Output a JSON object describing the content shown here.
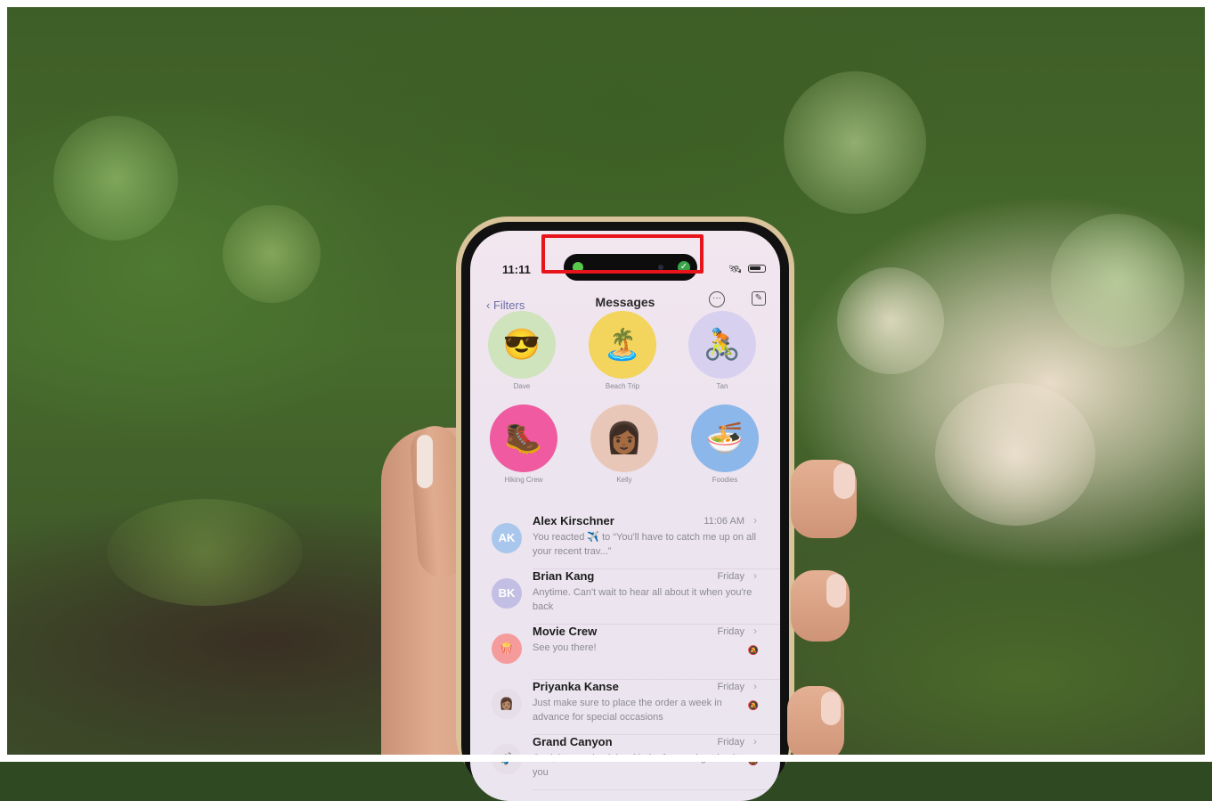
{
  "status_bar": {
    "time": "11:11",
    "battery_level": 0.8
  },
  "nav": {
    "back_label": "Filters",
    "title": "Messages",
    "more_icon": "ellipsis-circle-icon",
    "compose_icon": "compose-icon"
  },
  "pinned": [
    {
      "label": "Dave",
      "emoji": "😎",
      "bg": "#cfe3bd"
    },
    {
      "label": "Beach Trip",
      "emoji": "🏝️",
      "bg": "#f3d45d"
    },
    {
      "label": "Tan",
      "emoji": "🚴",
      "bg": "#d8d0ef"
    },
    {
      "label": "Hiking Crew",
      "emoji": "🥾",
      "bg": "#ef5aa0"
    },
    {
      "label": "Kelly",
      "emoji": "👩🏾",
      "bg": "#e9c7b8"
    },
    {
      "label": "Foodies",
      "emoji": "🍜",
      "bg": "#8cb7ea"
    }
  ],
  "conversations": [
    {
      "name": "Alex Kirschner",
      "date": "11:06 AM",
      "initials": "AK",
      "avatar_bg": "#a9c6ec",
      "preview": "You reacted ✈️ to “You'll have to catch me up on all your recent trav...”",
      "muted": false
    },
    {
      "name": "Brian Kang",
      "date": "Friday",
      "initials": "BK",
      "avatar_bg": "#c3bfe4",
      "preview": "Anytime. Can't wait to hear all about it when you're back",
      "muted": false
    },
    {
      "name": "Movie Crew",
      "date": "Friday",
      "initials": "🍿",
      "avatar_bg": "#f59b9b",
      "preview": "See you there!",
      "muted": true
    },
    {
      "name": "Priyanka Kanse",
      "date": "Friday",
      "initials": "👩🏽",
      "avatar_bg": "#e6dfe8",
      "preview": "Just make sure to place the order a week in advance for special occasions",
      "muted": true
    },
    {
      "name": "Grand Canyon",
      "date": "Friday",
      "initials": "🧳",
      "avatar_bg": "#e6dfe8",
      "preview": "Cool, let me check in with the fam and get back to you",
      "muted": true
    }
  ],
  "colors": {
    "highlight": "#e8141c",
    "accent": "#6f6fa8"
  }
}
